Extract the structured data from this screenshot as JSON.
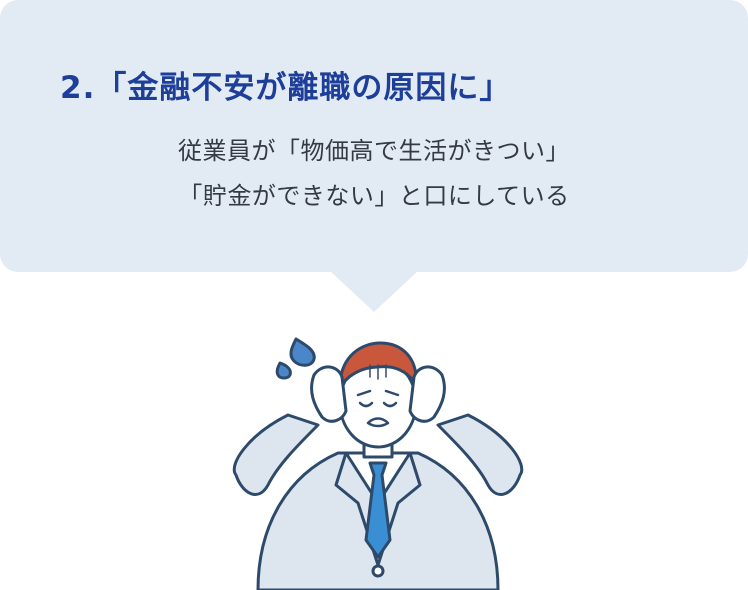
{
  "speech_bubble": {
    "title": "2.「金融不安が離職の原因に」",
    "line1": "従業員が「物価高で生活がきつい」",
    "line2": "「貯金ができない」と口にしている"
  },
  "illustration": {
    "icon": "stressed-businessman-icon",
    "colors": {
      "outline": "#2e4a6b",
      "suit": "#dde6ef",
      "tie": "#3a8fd4",
      "hair": "#c9573c",
      "skin": "#ffffff",
      "sweat": "#4a86c8"
    }
  },
  "colors": {
    "bubble": "#e2ebf4",
    "title": "#1d3f9a",
    "text": "#333a43"
  }
}
